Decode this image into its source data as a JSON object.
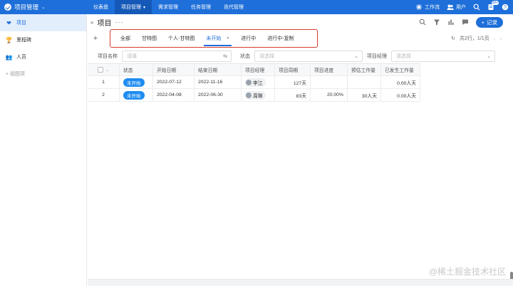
{
  "app": {
    "name": "项目管理"
  },
  "topnav": [
    {
      "label": "仪表盘",
      "active": false
    },
    {
      "label": "项目管理",
      "active": true
    },
    {
      "label": "需求管理",
      "active": false
    },
    {
      "label": "任务管理",
      "active": false
    },
    {
      "label": "迭代管理",
      "active": false
    }
  ],
  "topright": {
    "workflow": "工作流",
    "users": "用户",
    "notify_badge": "99+"
  },
  "sidebar": {
    "items": [
      {
        "label": "项目",
        "icon": "heart-icon",
        "active": true
      },
      {
        "label": "里程碑",
        "icon": "trophy-icon",
        "active": false
      },
      {
        "label": "人员",
        "icon": "people-icon",
        "active": false
      },
      {
        "label": "+ 视图项",
        "icon": "",
        "active": false
      }
    ]
  },
  "page": {
    "title": "项目",
    "add_label": "记录"
  },
  "tabs": [
    {
      "label": "全部",
      "active": false
    },
    {
      "label": "甘特图",
      "active": false
    },
    {
      "label": "个人-甘特图",
      "active": false
    },
    {
      "label": "未开始",
      "active": true
    },
    {
      "label": "进行中",
      "active": false
    },
    {
      "label": "进行中-复制",
      "active": false
    }
  ],
  "pager": {
    "summary": "共2行，1/1页"
  },
  "filters": {
    "name_label": "项目名称",
    "name_placeholder": "请填",
    "status_label": "状态",
    "status_placeholder": "请选择",
    "manager_label": "项目经理",
    "manager_placeholder": "请选择"
  },
  "table": {
    "columns": [
      "状态",
      "开始日期",
      "结束日期",
      "项目经理",
      "项目周期",
      "项目进度",
      "预估工作量",
      "已发生工作量"
    ],
    "rows": [
      {
        "index": "1",
        "status": "未开始",
        "start": "2022-07-12",
        "end": "2022-11-16",
        "manager": "李江",
        "period": "127天",
        "progress": "",
        "estimate": "",
        "actual": "0.00人天"
      },
      {
        "index": "2",
        "status": "未开始",
        "start": "2022-04-08",
        "end": "2022-06-30",
        "manager": "周琳",
        "period": "83天",
        "progress": "20.00%",
        "estimate": "30人天",
        "actual": "0.00人天"
      }
    ]
  },
  "watermark": "@稀土掘金技术社区",
  "colors": {
    "primary": "#1e6fd9",
    "highlight_box": "#d93b2b",
    "status_pill": "#1e8cf0"
  }
}
